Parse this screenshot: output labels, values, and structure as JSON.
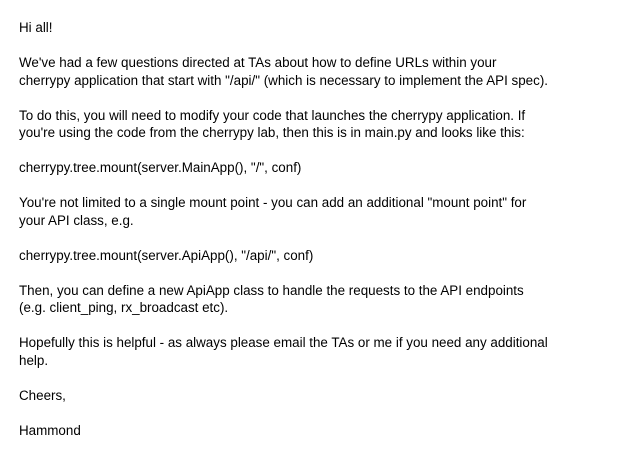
{
  "message": {
    "greeting": "Hi all!",
    "p1": [
      "We've had a few questions directed at TAs about how to define URLs within your",
      "cherrypy application that start with \"/api/\" (which is necessary to implement the API spec)."
    ],
    "p2": [
      "To do this, you will need to modify your code that launches the cherrypy application. If",
      "you're using the code from the cherrypy lab, then this is in main.py and looks like this:"
    ],
    "code1": "cherrypy.tree.mount(server.MainApp(), \"/\", conf)",
    "p3": [
      "You're not limited to a single mount point - you can add an additional \"mount point\" for",
      "your API class, e.g."
    ],
    "code2": "cherrypy.tree.mount(server.ApiApp(), \"/api/\", conf)",
    "p4": [
      "Then, you can define a new ApiApp class to handle the requests to the API endpoints",
      "(e.g. client_ping, rx_broadcast etc)."
    ],
    "p5": [
      "Hopefully this is helpful - as always please email the TAs or me if you need any additional",
      "help."
    ],
    "signoff": "Cheers,",
    "signature": "Hammond"
  }
}
